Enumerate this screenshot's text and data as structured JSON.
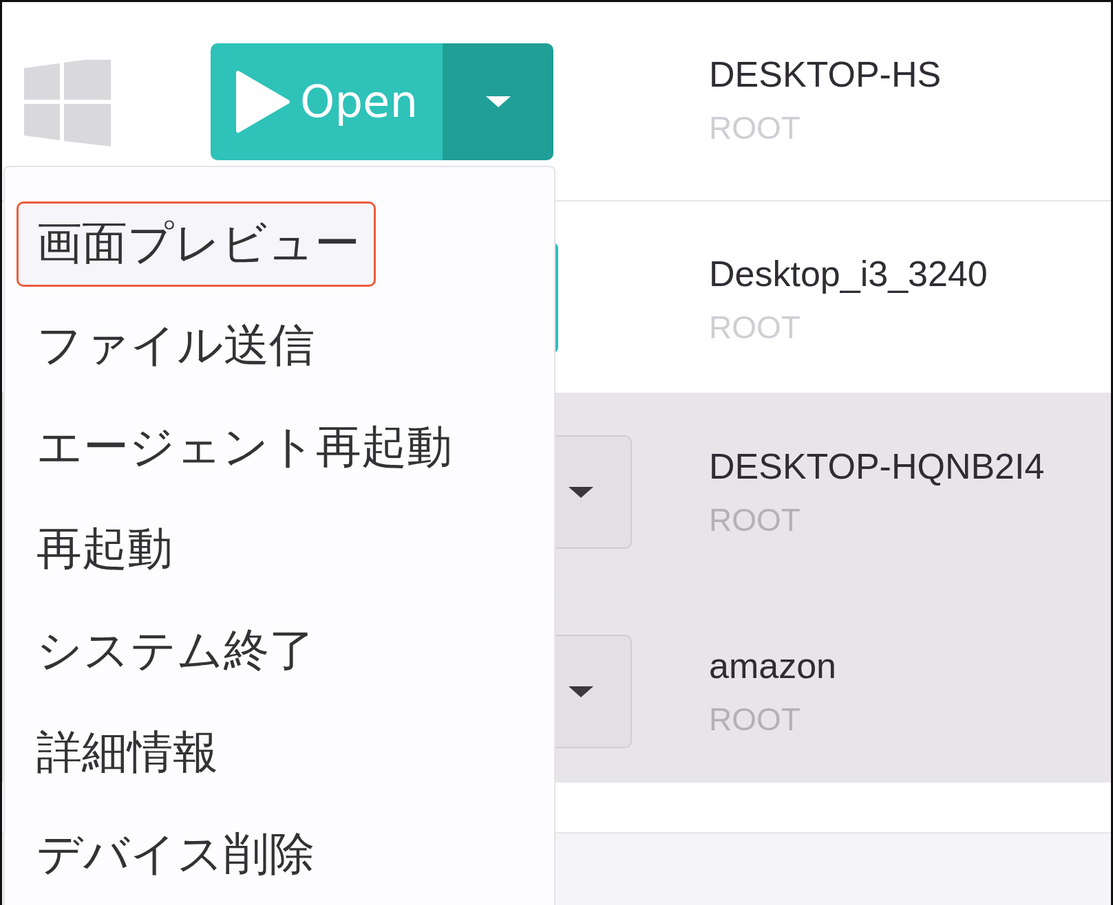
{
  "open_button": {
    "label": "Open"
  },
  "devices": [
    {
      "name": "DESKTOP-HS",
      "user": "ROOT",
      "online": true
    },
    {
      "name": "Desktop_i3_3240",
      "user": "ROOT",
      "online": true
    },
    {
      "name": "DESKTOP-HQNB2I4",
      "user": "ROOT",
      "online": false
    },
    {
      "name": "amazon",
      "user": "ROOT",
      "online": false
    }
  ],
  "menu": {
    "items": [
      {
        "label": "画面プレビュー",
        "selected": true
      },
      {
        "label": "ファイル送信",
        "selected": false
      },
      {
        "label": "エージェント再起動",
        "selected": false
      },
      {
        "label": "再起動",
        "selected": false
      },
      {
        "label": "システム終了",
        "selected": false
      },
      {
        "label": "詳細情報",
        "selected": false
      },
      {
        "label": "デバイス削除",
        "selected": false
      }
    ]
  }
}
